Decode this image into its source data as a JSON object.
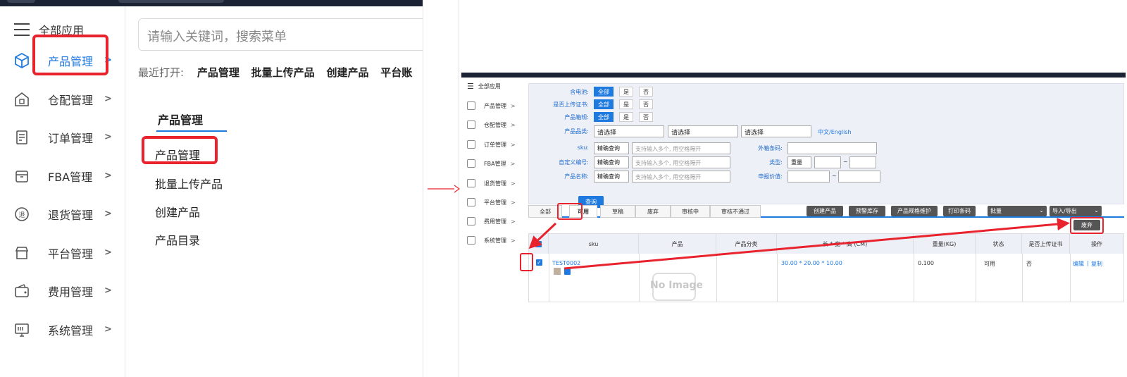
{
  "left": {
    "menu_header": "全部应用",
    "menu": [
      {
        "label": "产品管理",
        "icon": "cube-icon"
      },
      {
        "label": "仓配管理",
        "icon": "warehouse-icon"
      },
      {
        "label": "订单管理",
        "icon": "document-icon"
      },
      {
        "label": "FBA管理",
        "icon": "box-icon"
      },
      {
        "label": "退货管理",
        "icon": "return-icon"
      },
      {
        "label": "平台管理",
        "icon": "store-icon"
      },
      {
        "label": "费用管理",
        "icon": "wallet-icon"
      },
      {
        "label": "系统管理",
        "icon": "monitor-icon"
      }
    ],
    "search_placeholder": "请输入关键词，搜索菜单",
    "recent_label": "最近打开:",
    "recent_items": [
      "产品管理",
      "批量上传产品",
      "创建产品",
      "平台账"
    ],
    "submenu_title": "产品管理",
    "submenu_items": [
      "产品管理",
      "批量上传产品",
      "创建产品",
      "产品目录"
    ]
  },
  "right": {
    "menu_header": "全部应用",
    "menu": [
      "产品管理",
      "仓配管理",
      "订单管理",
      "FBA管理",
      "退货管理",
      "平台管理",
      "费用管理",
      "系统管理"
    ],
    "filters": {
      "battery_label": "含电池:",
      "cert_label": "是否上传证书:",
      "box_label": "产品箱规:",
      "opt_all": "全部",
      "opt_yes": "是",
      "opt_no": "否",
      "category_label": "产品品类:",
      "select_placeholder": "请选择",
      "lang_link": "中文/English",
      "sku_label": "sku:",
      "custom_code_label": "自定义编号:",
      "name_label": "产品名称:",
      "match_mode": "精确查询",
      "multi_placeholder": "支持输入多个, 用空格隔开",
      "outer_barcode_label": "外箱条码:",
      "type_label": "类型:",
      "type_value": "重量",
      "declared_label": "申报价值:",
      "tilde": "~",
      "query_button": "查询"
    },
    "tabs": [
      "全部",
      "可用",
      "草稿",
      "废弃",
      "审核中",
      "审核不通过"
    ],
    "actions": [
      "创建产品",
      "预警库存",
      "产品规格维护",
      "打印条码"
    ],
    "batch_label": "批量",
    "import_export_label": "导入/导出",
    "discard_button": "废弃",
    "table": {
      "headers": [
        "sku",
        "产品",
        "产品分类",
        "长 * 宽 * 高 (CM)",
        "重量(KG)",
        "状态",
        "是否上传证书",
        "操作"
      ],
      "row": {
        "sku": "TEST0002",
        "image_text": "No Image",
        "dims": "30.00 * 20.00 * 10.00",
        "weight": "0.100",
        "status": "可用",
        "cert": "否",
        "edit": "编辑",
        "sep": "|",
        "copy": "复制"
      }
    }
  },
  "colors": {
    "accent": "#1f7ae0",
    "highlight": "#e8232e",
    "topbar": "#1b2233"
  }
}
